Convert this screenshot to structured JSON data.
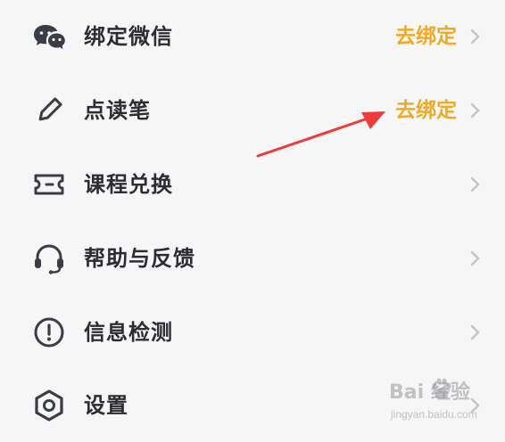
{
  "menu": {
    "items": [
      {
        "label": "绑定微信",
        "action": "去绑定",
        "icon": "wechat-icon"
      },
      {
        "label": "点读笔",
        "action": "去绑定",
        "icon": "pen-icon"
      },
      {
        "label": "课程兑换",
        "action": "",
        "icon": "ticket-icon"
      },
      {
        "label": "帮助与反馈",
        "action": "",
        "icon": "headset-icon"
      },
      {
        "label": "信息检测",
        "action": "",
        "icon": "alert-circle-icon"
      },
      {
        "label": "设置",
        "action": "",
        "icon": "hexagon-settings-icon"
      }
    ]
  },
  "watermark": {
    "brand": "Bai  经验",
    "site": "jingyan.baidu.com"
  },
  "colors": {
    "accent": "#f0ab22",
    "text": "#2b2d33",
    "icon": "#3a3d45",
    "annotation": "#ee3b3b",
    "background": "#f6f6f7"
  }
}
